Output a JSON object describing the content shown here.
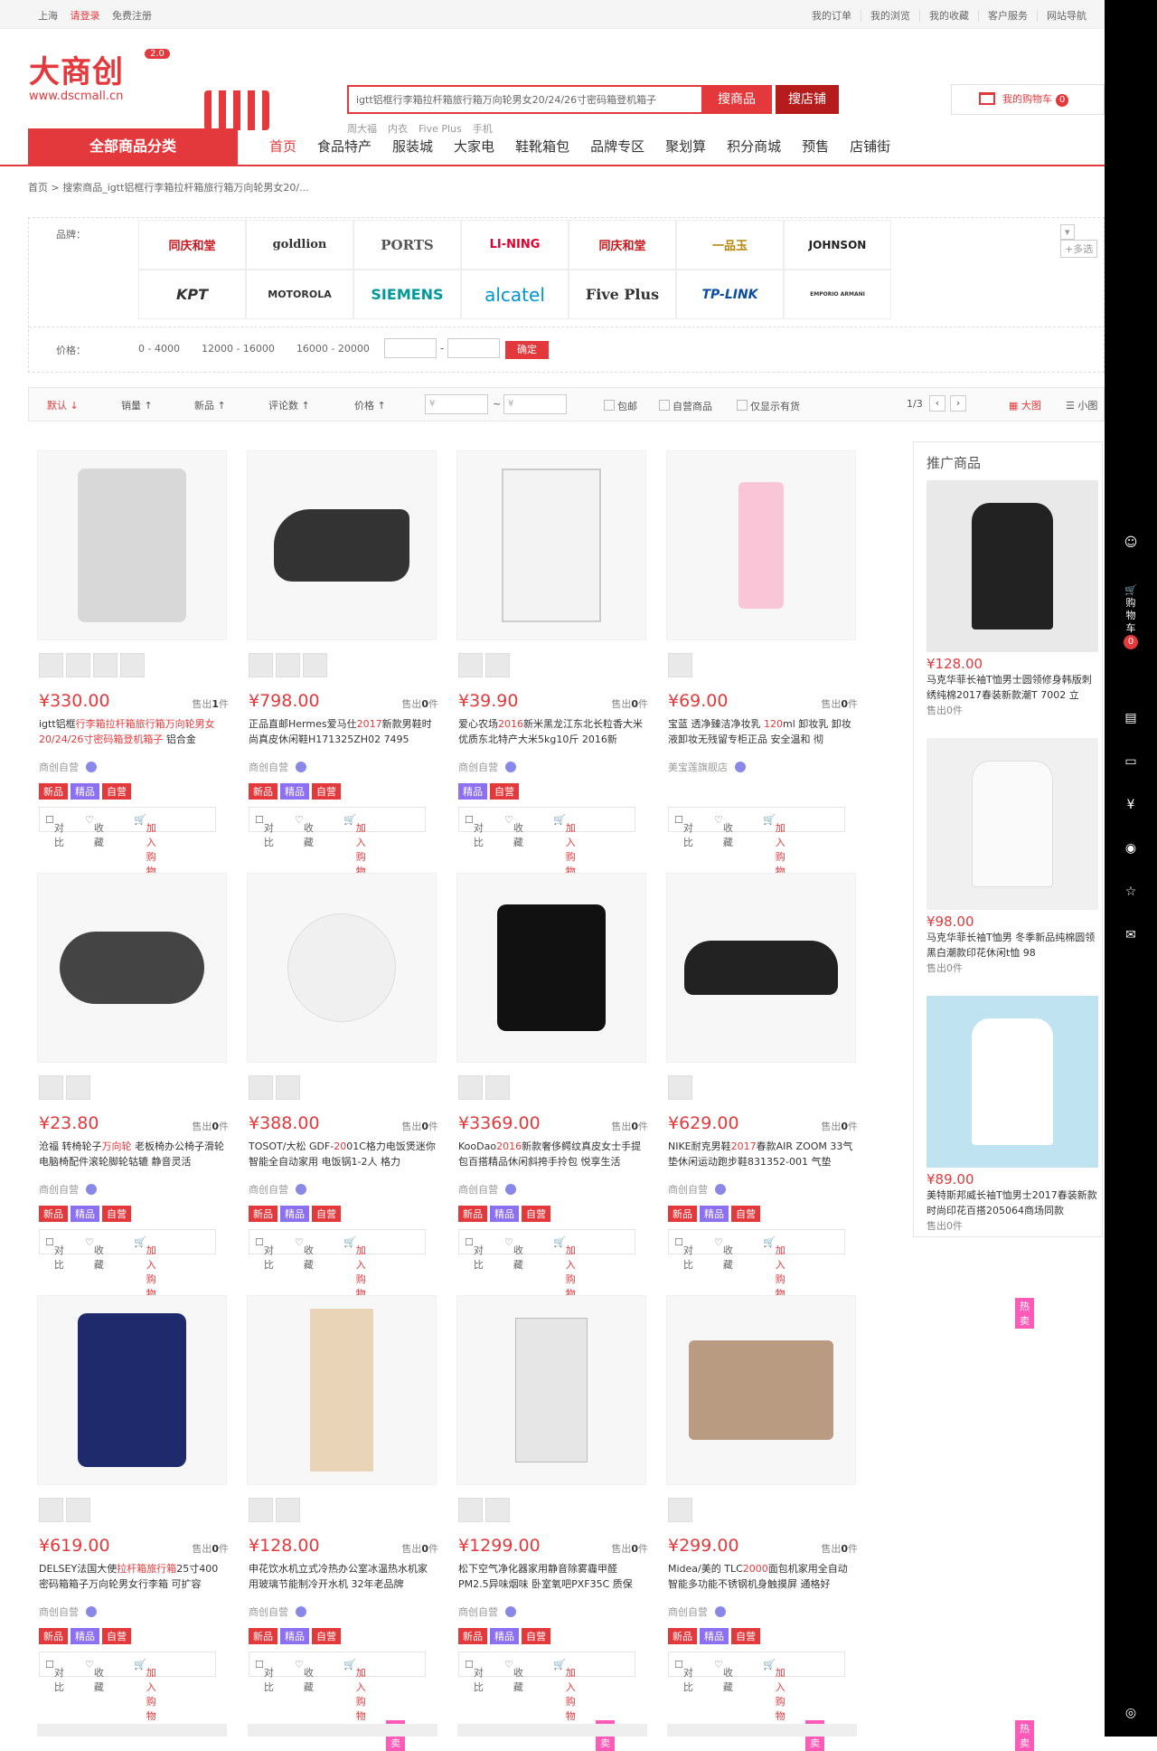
{
  "topbar": {
    "location": "上海",
    "login": "请登录",
    "register": "免费注册",
    "links": [
      "我的订单",
      "我的浏览",
      "我的收藏",
      "客户服务",
      "网站导航"
    ]
  },
  "logo": {
    "text": "大商创",
    "version": "2.0",
    "url": "www.dscmall.cn"
  },
  "search": {
    "query": "igtt铝框行李箱拉杆箱旅行箱万向轮男女20/24/26寸密码箱登机箱子",
    "btn_goods": "搜商品",
    "btn_shop": "搜店铺",
    "hot": [
      "周大福",
      "内衣",
      "Five Plus",
      "手机"
    ]
  },
  "cart": {
    "label": "我的购物车",
    "count": "0"
  },
  "nav": {
    "category": "全部商品分类",
    "items": [
      "首页",
      "食品特产",
      "服装城",
      "大家电",
      "鞋靴箱包",
      "品牌专区",
      "聚划算",
      "积分商城",
      "预售",
      "店铺街"
    ]
  },
  "breadcrumb": {
    "home": "首页",
    "current": "搜索商品_igtt铝框行李箱拉杆箱旅行箱万向轮男女20/..."
  },
  "filter": {
    "brand_label": "品牌：",
    "brands": [
      "同庆和堂",
      "goldlion",
      "PORTS",
      "LI-NING",
      "同庆和堂",
      "一品玉",
      "JOHNSON",
      "KPT",
      "MOTOROLA",
      "SIEMENS",
      "alcatel",
      "Five Plus",
      "TP-LINK",
      "EMPORIO ARMANI"
    ],
    "multi": "+多选",
    "price_label": "价格：",
    "price_ranges": [
      "0 - 4000",
      "12000 - 16000",
      "16000 - 20000"
    ],
    "confirm": "确定"
  },
  "sortbar": {
    "sorts": [
      "默认",
      "销量",
      "新品",
      "评论数",
      "价格"
    ],
    "price_from": "¥",
    "price_to": "¥",
    "checks": [
      "包邮",
      "自营商品",
      "仅显示有货"
    ],
    "page": "1/3",
    "view_big": "大图",
    "view_small": "小图"
  },
  "products": [
    {
      "price": "¥330.00",
      "sold": "1",
      "title_pre": "igtt铝框",
      "title_hl": "行李箱拉杆箱旅行箱万向轮男女20/24/26寸密码箱登机箱子",
      "title_post": " 铝合金",
      "shop": "商创自营",
      "tags": [
        "新品",
        "热卖",
        "精品",
        "自营"
      ]
    },
    {
      "price": "¥798.00",
      "sold": "0",
      "title_pre": "正品直邮Hermes爱马仕",
      "title_hl": "2017",
      "title_post": "新款男鞋时尚真皮休闲鞋H171325ZH02 7495",
      "shop": "商创自营",
      "tags": [
        "新品",
        "热卖",
        "精品",
        "自营"
      ]
    },
    {
      "price": "¥39.90",
      "sold": "0",
      "title_pre": "爱心农场",
      "title_hl": "2016",
      "title_post": "新米黑龙江东北长粒香大米优质东北特产大米5kg10斤 2016新",
      "shop": "商创自营",
      "tags": [
        "精品",
        "自营"
      ]
    },
    {
      "price": "¥69.00",
      "sold": "0",
      "title_pre": "宝蓝 透净臻洁净妆乳 ",
      "title_hl": "120",
      "title_post": "ml 卸妆乳 卸妆液卸妆无残留专柜正品 安全温和 彻",
      "shop": "美宝莲旗舰店",
      "tags": []
    },
    {
      "price": "¥23.80",
      "sold": "0",
      "title_pre": "沧福 转椅轮子",
      "title_hl": "万向轮",
      "title_post": " 老板椅办公椅子滑轮电脑椅配件滚轮脚轮轱辘 静音灵活",
      "shop": "商创自营",
      "tags": [
        "新品",
        "热卖",
        "精品",
        "自营"
      ]
    },
    {
      "price": "¥388.00",
      "sold": "0",
      "title_pre": "TOSOT/大松 GDF-",
      "title_hl": "20",
      "title_post": "01C格力电饭煲迷你智能全自动家用 电饭锅1-2人 格力",
      "shop": "商创自营",
      "tags": [
        "新品",
        "热卖",
        "精品",
        "自营"
      ]
    },
    {
      "price": "¥3369.00",
      "sold": "0",
      "title_pre": "KooDao",
      "title_hl": "2016",
      "title_post": "新款奢侈鳄纹真皮女士手提包百搭精品休闲斜挎手拎包 悦享生活",
      "shop": "商创自营",
      "tags": [
        "新品",
        "热卖",
        "精品",
        "自营"
      ]
    },
    {
      "price": "¥629.00",
      "sold": "0",
      "title_pre": "NIKE耐克男鞋",
      "title_hl": "2017",
      "title_post": "春款AIR ZOOM 33气垫休闲运动跑步鞋831352-001 气垫",
      "shop": "商创自营",
      "tags": [
        "新品",
        "热卖",
        "精品",
        "自营"
      ]
    },
    {
      "price": "¥619.00",
      "sold": "0",
      "title_pre": "DELSEY法国大使",
      "title_hl": "拉杆箱旅行箱",
      "title_post": "25寸400密码箱箱子万向轮男女行李箱 可扩容",
      "shop": "商创自营",
      "tags": [
        "新品",
        "热卖",
        "精品",
        "自营"
      ]
    },
    {
      "price": "¥128.00",
      "sold": "0",
      "title_pre": "申花饮水机立式冷热办公室冰温热水机家用玻璃节能制冷开水机 32年老品牌",
      "title_hl": "",
      "title_post": "",
      "shop": "商创自营",
      "tags": [
        "新品",
        "热卖",
        "精品",
        "自营"
      ]
    },
    {
      "price": "¥1299.00",
      "sold": "0",
      "title_pre": "松下空气净化器家用静音除雾霾甲醛PM2.5异味烟味 卧室氧吧PXF35C 质保",
      "title_hl": "",
      "title_post": "",
      "shop": "商创自营",
      "tags": [
        "新品",
        "热卖",
        "精品",
        "自营"
      ]
    },
    {
      "price": "¥299.00",
      "sold": "0",
      "title_pre": "Midea/美的 TLC",
      "title_hl": "2000",
      "title_post": "面包机家用全自动智能多功能不锈钢机身触摸屏 通格好",
      "shop": "商创自营",
      "tags": [
        "新品",
        "热卖",
        "精品",
        "自营"
      ]
    }
  ],
  "product_actions": {
    "compare": "对比",
    "collect": "收藏",
    "add": "加入购物车",
    "sold_prefix": "售出",
    "sold_suffix": "件"
  },
  "promo": {
    "title": "推广商品",
    "items": [
      {
        "price": "¥128.00",
        "title": "马克华菲长袖T恤男士圆领修身韩版刺绣纯棉2017春装新款潮T 7002 立",
        "sold": "售出0件"
      },
      {
        "price": "¥98.00",
        "title": "马克华菲长袖T恤男 冬季新品纯棉圆领黑白潮款印花休闲t恤 98",
        "sold": "售出0件"
      },
      {
        "price": "¥89.00",
        "title": "美特斯邦威长袖T恤男士2017春装新款时尚印花百搭205064商场同款",
        "sold": "售出0件"
      }
    ]
  },
  "rightbar": {
    "cart_label": "购物车",
    "cart_count": "0"
  },
  "colors": {
    "accent": "#e4393c"
  }
}
